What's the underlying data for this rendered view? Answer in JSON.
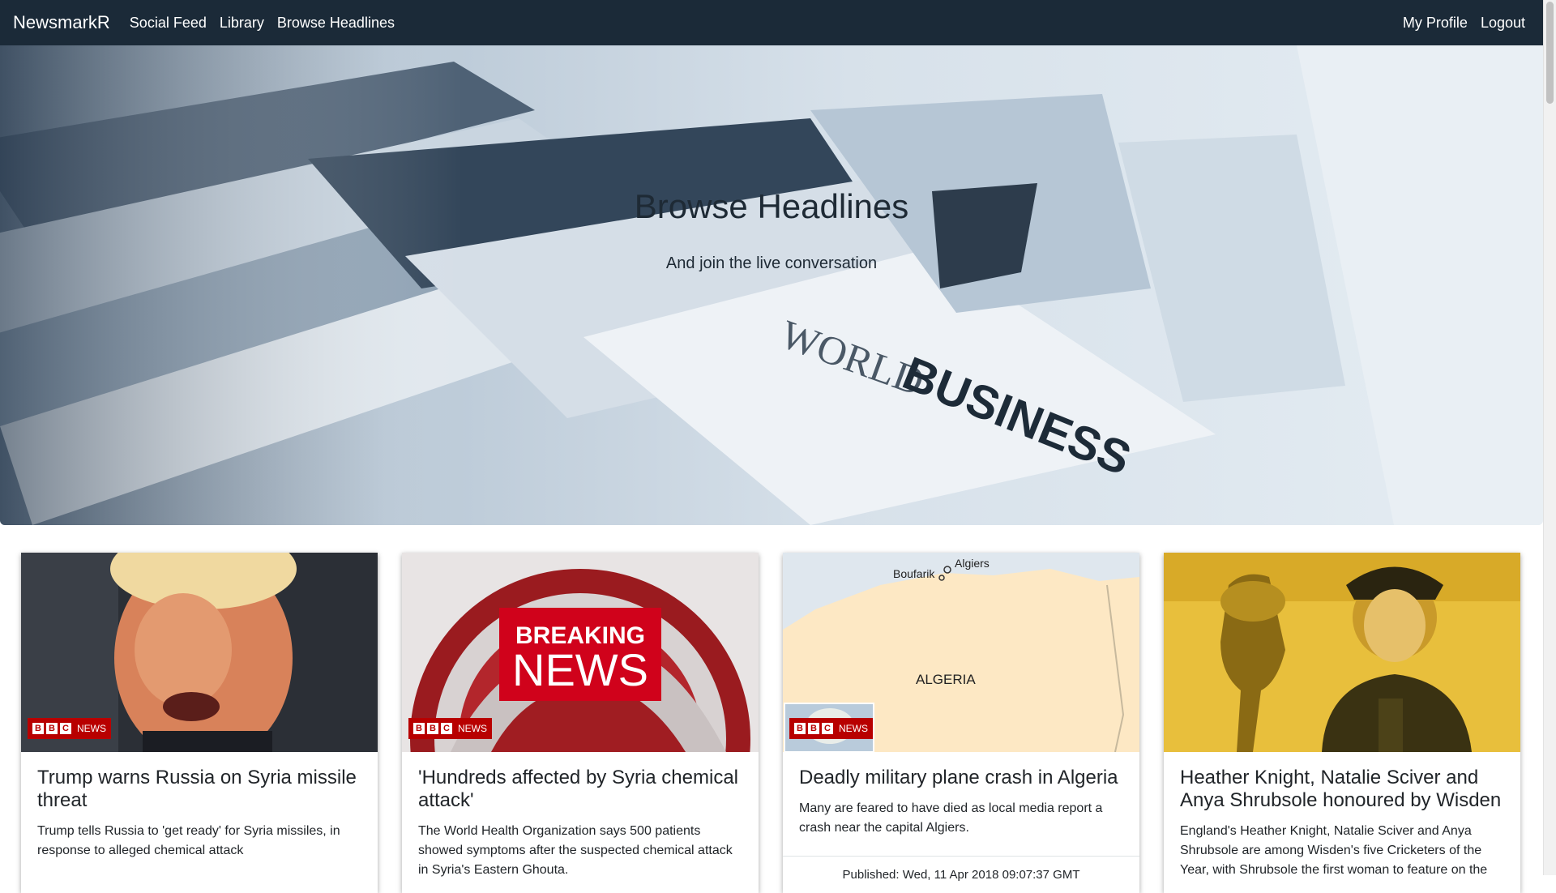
{
  "navbar": {
    "brand": "NewsmarkR",
    "links": [
      "Social Feed",
      "Library",
      "Browse Headlines"
    ],
    "right_links": [
      "My Profile",
      "Logout"
    ]
  },
  "hero": {
    "title": "Browse Headlines",
    "subtitle": "And join the live conversation",
    "image_text": [
      "WORLD",
      "BUSINESS"
    ]
  },
  "badge": {
    "letters": [
      "B",
      "B",
      "C"
    ],
    "label": "NEWS"
  },
  "cards": [
    {
      "title": "Trump warns Russia on Syria missile threat",
      "description": "Trump tells Russia to 'get ready' for Syria missiles, in response to alleged chemical attack"
    },
    {
      "title": "'Hundreds affected by Syria chemical attack'",
      "description": "The World Health Organization says 500 patients showed symptoms after the suspected chemical attack in Syria's Eastern Ghouta.",
      "image_text": [
        "BREAKING",
        "NEWS"
      ]
    },
    {
      "title": "Deadly military plane crash in Algeria",
      "description": "Many are feared to have died as local media report a crash near the capital Algiers.",
      "published": "Published: Wed, 11 Apr 2018 09:07:37 GMT",
      "map_labels": {
        "city1": "Algiers",
        "city2": "Boufarik",
        "country": "ALGERIA"
      }
    },
    {
      "title": "Heather Knight, Natalie Sciver and Anya Shrubsole honoured by Wisden",
      "description": "England's Heather Knight, Natalie Sciver and Anya Shrubsole are among Wisden's five Cricketers of the Year, with Shrubsole the first woman to feature on the"
    }
  ],
  "colors": {
    "navbar": "#1b2a38",
    "bbc_red": "#b80000",
    "breaking_red": "#d0021b",
    "map_land": "#fde8c4",
    "map_sea": "#dfe7ee",
    "cricket_yellow": "#e8bf3c"
  }
}
